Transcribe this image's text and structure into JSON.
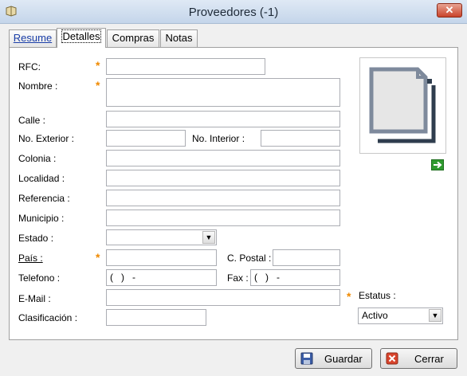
{
  "window": {
    "title": "Proveedores (-1)",
    "close_glyph": "✕"
  },
  "tabs": [
    {
      "label": "Resume"
    },
    {
      "label": "Detalles"
    },
    {
      "label": "Compras"
    },
    {
      "label": "Notas"
    }
  ],
  "form": {
    "rfc": {
      "label": "RFC:",
      "value": ""
    },
    "nombre": {
      "label": "Nombre :",
      "value": ""
    },
    "calle": {
      "label": "Calle :",
      "value": ""
    },
    "no_exterior": {
      "label": "No. Exterior :",
      "value": ""
    },
    "no_interior": {
      "label": "No. Interior :",
      "value": ""
    },
    "colonia": {
      "label": "Colonia :",
      "value": ""
    },
    "localidad": {
      "label": "Localidad :",
      "value": ""
    },
    "referencia": {
      "label": "Referencia :",
      "value": ""
    },
    "municipio": {
      "label": "Municipio :",
      "value": ""
    },
    "estado": {
      "label": "Estado :",
      "value": ""
    },
    "pais": {
      "label": "País :",
      "value": ""
    },
    "c_postal": {
      "label": "C. Postal :",
      "value": ""
    },
    "telefono": {
      "label": "Telefono :",
      "value": "(   )   -"
    },
    "fax": {
      "label": "Fax :",
      "value": "(   )   -"
    },
    "email": {
      "label": "E-Mail :",
      "value": ""
    },
    "clasificacion": {
      "label": "Clasificación :",
      "value": ""
    },
    "estatus": {
      "label": "Estatus :",
      "value": "Activo"
    }
  },
  "required_mark": "*",
  "buttons": {
    "save": "Guardar",
    "cancel": "Cerrar"
  },
  "colors": {
    "required": "#f08a00",
    "nav_arrow": "#2e9a2e"
  }
}
